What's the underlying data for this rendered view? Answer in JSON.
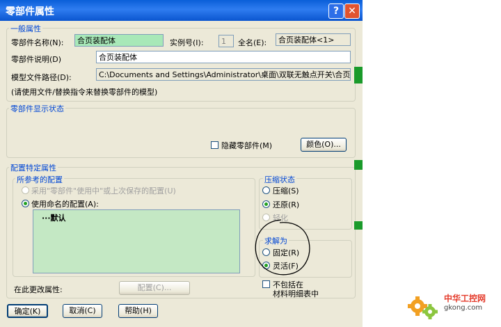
{
  "window": {
    "title": "零部件属性",
    "help_glyph": "?",
    "close_glyph": "✕"
  },
  "general": {
    "legend": "一般属性",
    "name_label": "零部件名称(N):",
    "name_value": "合页装配体",
    "instance_label": "实例号(I):",
    "instance_value": "1",
    "fullname_label": "全名(E):",
    "fullname_value": "合页装配体<1>",
    "desc_label": "零部件说明(D)",
    "desc_value": "合页装配体",
    "path_label": "模型文件路径(D):",
    "path_value": "C:\\Documents and Settings\\Administrator\\桌面\\双联无触点开关\\合页装配",
    "hint": "(请使用文件/替换指令来替换零部件的模型)"
  },
  "display": {
    "legend": "零部件显示状态",
    "hide_label": "隐藏零部件(M)",
    "color_button": "颜色(O)..."
  },
  "config": {
    "legend": "配置特定属性",
    "ref_legend": "所参考的配置",
    "opt_used": "采用\"零部件\"使用中\"或上次保存的配置(U)",
    "opt_named": "使用命名的配置(A):",
    "list_item": "默认",
    "change_label": "在此更改属性:",
    "config_button": "配置(C)..."
  },
  "suppress": {
    "legend": "压缩状态",
    "opt1": "压缩(S)",
    "opt2": "还原(R)",
    "opt3": "轻化"
  },
  "solve": {
    "legend": "求解为",
    "opt1": "固定(R)",
    "opt2": "灵活(F)"
  },
  "bom": {
    "line1": "不包括在",
    "line2": "材料明细表中"
  },
  "footer": {
    "ok": "确定(K)",
    "cancel": "取消(C)",
    "help": "帮助(H)"
  },
  "watermark": {
    "cn": "中华工控网",
    "en": "gkong.com"
  }
}
